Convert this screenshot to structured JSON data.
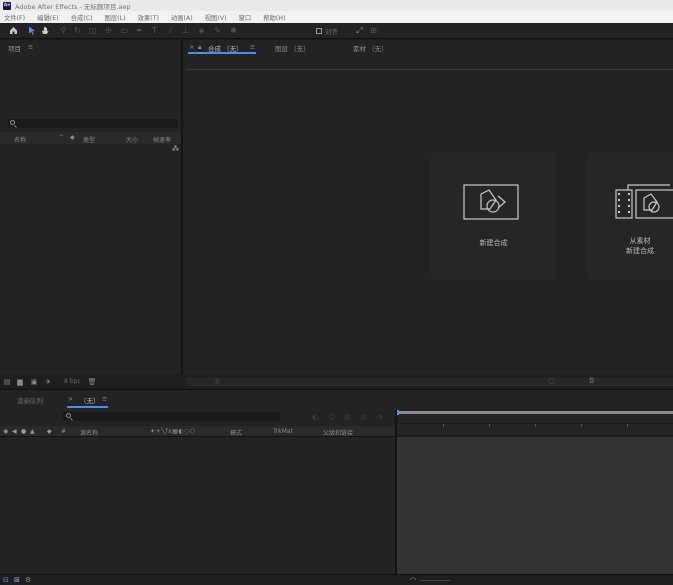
{
  "window": {
    "app_logo": "Ae",
    "title": "Adobe After Effects - 无标题项目.aep"
  },
  "menu": [
    "文件(F)",
    "编辑(E)",
    "合成(C)",
    "图层(L)",
    "效果(T)",
    "动画(A)",
    "视图(V)",
    "窗口",
    "帮助(H)"
  ],
  "toolbar": {
    "snap_label": "对齐",
    "icons": [
      "home-icon",
      "selection-tool-icon",
      "hand-tool-icon",
      "zoom-tool-icon",
      "rotate-tool-icon",
      "camera-tool-icon",
      "pan-behind-tool-icon",
      "rectangle-tool-icon",
      "pen-tool-icon",
      "text-tool-icon",
      "brush-tool-icon",
      "clone-stamp-tool-icon",
      "eraser-tool-icon",
      "roto-brush-tool-icon",
      "puppet-tool-icon"
    ]
  },
  "project_panel": {
    "title": "项目",
    "menu_icon": "≡",
    "columns": {
      "name": "名称",
      "type": "类型",
      "size": "大小",
      "frame_rate": "帧速率"
    },
    "footer_bpc": "8 bpc"
  },
  "viewer": {
    "tabs": [
      {
        "label": "合成 （无）",
        "active": true
      },
      {
        "label": "图层 （无）",
        "active": false
      },
      {
        "label": "素材 （无）",
        "active": false
      }
    ],
    "tab_menu_icon": "≡",
    "cards": [
      {
        "label": "新建合成"
      },
      {
        "label_line1": "从素材",
        "label_line2": "新建合成"
      }
    ]
  },
  "timeline": {
    "render_queue_tab": "渲染队列",
    "comp_tab": "（无）",
    "comp_tab_menu": "≡",
    "columns": {
      "source_name": "源名称",
      "mode": "模式",
      "trkmat": "TrkMat",
      "parent": "父级和链接",
      "hash": "#"
    }
  },
  "colors": {
    "accent": "#4d8cf0",
    "panel_bg": "#232323",
    "app_bg": "#1b1b1b",
    "track_bg": "#333333"
  }
}
